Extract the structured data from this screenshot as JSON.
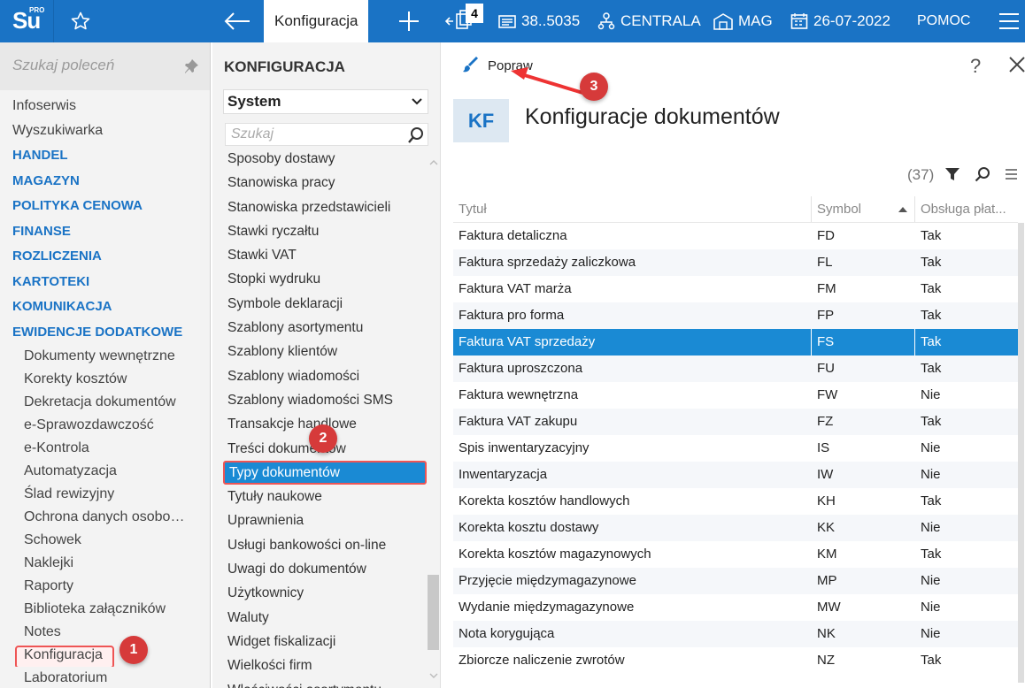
{
  "topbar": {
    "logo_main": "Su",
    "logo_sub": "PRO",
    "active_tab": "Konfiguracja",
    "window_count": "4",
    "account": "38..5035",
    "branch": "CENTRALA",
    "warehouse": "MAG",
    "date": "26-07-2022",
    "help": "POMOC",
    "accent": "#1a73c5"
  },
  "leftnav": {
    "search_placeholder": "Szukaj poleceń",
    "items": [
      {
        "label": "Infoserwis",
        "type": "norm"
      },
      {
        "label": "Wyszukiwarka",
        "type": "norm"
      },
      {
        "label": "HANDEL",
        "type": "sec"
      },
      {
        "label": "MAGAZYN",
        "type": "sec"
      },
      {
        "label": "POLITYKA CENOWA",
        "type": "sec"
      },
      {
        "label": "FINANSE",
        "type": "sec"
      },
      {
        "label": "ROZLICZENIA",
        "type": "sec"
      },
      {
        "label": "KARTOTEKI",
        "type": "sec"
      },
      {
        "label": "KOMUNIKACJA",
        "type": "sec"
      },
      {
        "label": "EWIDENCJE DODATKOWE",
        "type": "sec"
      },
      {
        "label": "Dokumenty wewnętrzne",
        "type": "sub"
      },
      {
        "label": "Korekty kosztów",
        "type": "sub"
      },
      {
        "label": "Dekretacja dokumentów",
        "type": "sub"
      },
      {
        "label": "e-Sprawozdawczość",
        "type": "sub"
      },
      {
        "label": "e-Kontrola",
        "type": "sub"
      },
      {
        "label": "Automatyzacja",
        "type": "sub"
      },
      {
        "label": "Ślad rewizyjny",
        "type": "sub"
      },
      {
        "label": "Ochrona danych osobo…",
        "type": "sub"
      },
      {
        "label": "Schowek",
        "type": "sub"
      },
      {
        "label": "Naklejki",
        "type": "sub"
      },
      {
        "label": "Raporty",
        "type": "sub"
      },
      {
        "label": "Biblioteka załączników",
        "type": "sub"
      },
      {
        "label": "Notes",
        "type": "sub"
      },
      {
        "label": "Konfiguracja",
        "type": "sub"
      },
      {
        "label": "Laboratorium",
        "type": "sub"
      }
    ]
  },
  "badges": {
    "b1": "1",
    "b2": "2",
    "b3": "3"
  },
  "midcol": {
    "title": "KONFIGURACJA",
    "select_value": "System",
    "search_placeholder": "Szukaj",
    "items": [
      "Sposoby dostawy",
      "Stanowiska pracy",
      "Stanowiska przedstawicieli",
      "Stawki ryczałtu",
      "Stawki VAT",
      "Stopki wydruku",
      "Symbole deklaracji",
      "Szablony asortymentu",
      "Szablony klientów",
      "Szablony wiadomości",
      "Szablony wiadomości SMS",
      "Transakcje handlowe",
      "Treści dokumentów",
      "Typy dokumentów",
      "Tytuły naukowe",
      "Uprawnienia",
      "Usługi bankowości on-line",
      "Uwagi do dokumentów",
      "Użytkownicy",
      "Waluty",
      "Widget fiskalizacji",
      "Wielkości firm",
      "Właściwości asortymentu"
    ],
    "selected_index": 13
  },
  "main": {
    "edit_label": "Popraw",
    "help": "?",
    "kf": "KF",
    "title": "Konfiguracje dokumentów",
    "count": "(37)",
    "columns": [
      "Tytuł",
      "Symbol",
      "Obsługa płat..."
    ],
    "rows": [
      [
        "Faktura detaliczna",
        "FD",
        "Tak"
      ],
      [
        "Faktura sprzedaży zaliczkowa",
        "FL",
        "Tak"
      ],
      [
        "Faktura VAT marża",
        "FM",
        "Tak"
      ],
      [
        "Faktura pro forma",
        "FP",
        "Tak"
      ],
      [
        "Faktura VAT sprzedaży",
        "FS",
        "Tak"
      ],
      [
        "Faktura uproszczona",
        "FU",
        "Tak"
      ],
      [
        "Faktura wewnętrzna",
        "FW",
        "Nie"
      ],
      [
        "Faktura VAT zakupu",
        "FZ",
        "Tak"
      ],
      [
        "Spis inwentaryzacyjny",
        "IS",
        "Nie"
      ],
      [
        "Inwentaryzacja",
        "IW",
        "Nie"
      ],
      [
        "Korekta kosztów handlowych",
        "KH",
        "Tak"
      ],
      [
        "Korekta kosztu dostawy",
        "KK",
        "Nie"
      ],
      [
        "Korekta kosztów magazynowych",
        "KM",
        "Tak"
      ],
      [
        "Przyjęcie międzymagazynowe",
        "MP",
        "Nie"
      ],
      [
        "Wydanie międzymagazynowe",
        "MW",
        "Nie"
      ],
      [
        "Nota korygująca",
        "NK",
        "Nie"
      ],
      [
        "Zbiorcze naliczenie zwrotów",
        "NZ",
        "Tak"
      ]
    ],
    "selected_row": 4
  }
}
